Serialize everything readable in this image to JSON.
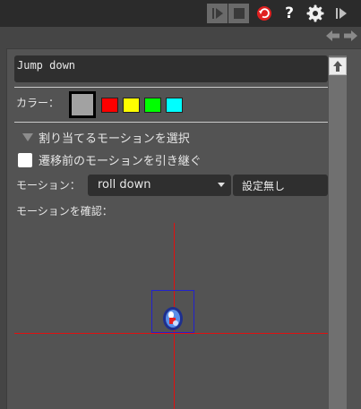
{
  "toolbar": {
    "buttons": [
      {
        "name": "play-icon"
      },
      {
        "name": "stop-icon"
      },
      {
        "name": "undo-icon",
        "color": "#e02020"
      },
      {
        "name": "help-icon",
        "label": "?"
      },
      {
        "name": "gear-icon"
      },
      {
        "name": "step-forward-icon"
      }
    ]
  },
  "nav": {
    "back": "arrow-left-icon",
    "forward": "arrow-right-icon"
  },
  "panel": {
    "title_value": "Jump down",
    "color_label": "カラー：",
    "colors": {
      "selected": "#a2a2a2",
      "options": [
        "#ff0000",
        "#ffff00",
        "#00ff00",
        "#00ffff"
      ]
    },
    "section_header": "割り当てるモーションを選択",
    "inherit_checkbox_label": "遷移前のモーションを引き継ぐ",
    "inherit_checked": false,
    "motion_label": "モーション：",
    "motion_value": "roll down",
    "setting_button": "設定無し",
    "confirm_label": "モーションを確認："
  }
}
